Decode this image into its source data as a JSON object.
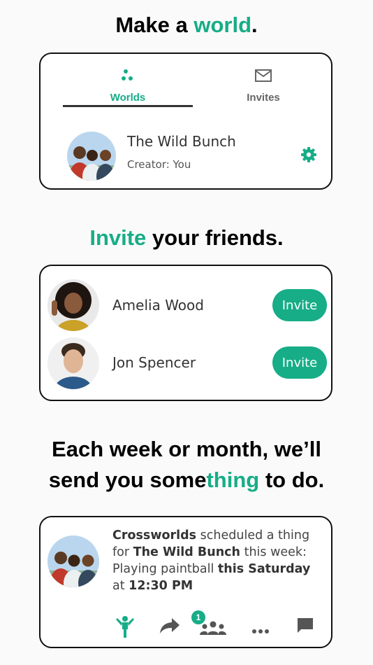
{
  "section1": {
    "headline_pre": "Make a ",
    "headline_accent": "world",
    "headline_post": "."
  },
  "worlds_card": {
    "tabs": [
      {
        "label": "Worlds",
        "icon": "worlds-dots-icon",
        "active": true
      },
      {
        "label": "Invites",
        "icon": "mail-icon",
        "active": false
      }
    ],
    "world": {
      "name": "The Wild Bunch",
      "creator": "Creator: You",
      "avatar": "group-photo-avatar"
    },
    "settings_icon": "gear-icon"
  },
  "section2": {
    "headline_accent": "Invite",
    "headline_post": " your friends."
  },
  "friends": [
    {
      "name": "Amelia Wood",
      "button": "Invite"
    },
    {
      "name": "Jon Spencer",
      "button": "Invite"
    }
  ],
  "section3": {
    "line1": "Each week or month, we’ll",
    "line2_pre": "send you some",
    "line2_accent": "thing",
    "line2_post": " to do."
  },
  "notification": {
    "sender": "Crossworlds",
    "t1": " scheduled a thing",
    "t2": "for ",
    "world": "The Wild Bunch",
    "t3": " this week:",
    "activity": "Playing paintball ",
    "when": "this Saturday",
    "t4": "at ",
    "time": "12:30 PM",
    "badge_count": "1",
    "actions": [
      "activity-person-icon",
      "share-arrow-icon",
      "people-group-icon",
      "more-dots-icon",
      "comment-icon"
    ]
  },
  "colors": {
    "accent": "#16ad87",
    "text": "#333333",
    "border": "#111111"
  }
}
